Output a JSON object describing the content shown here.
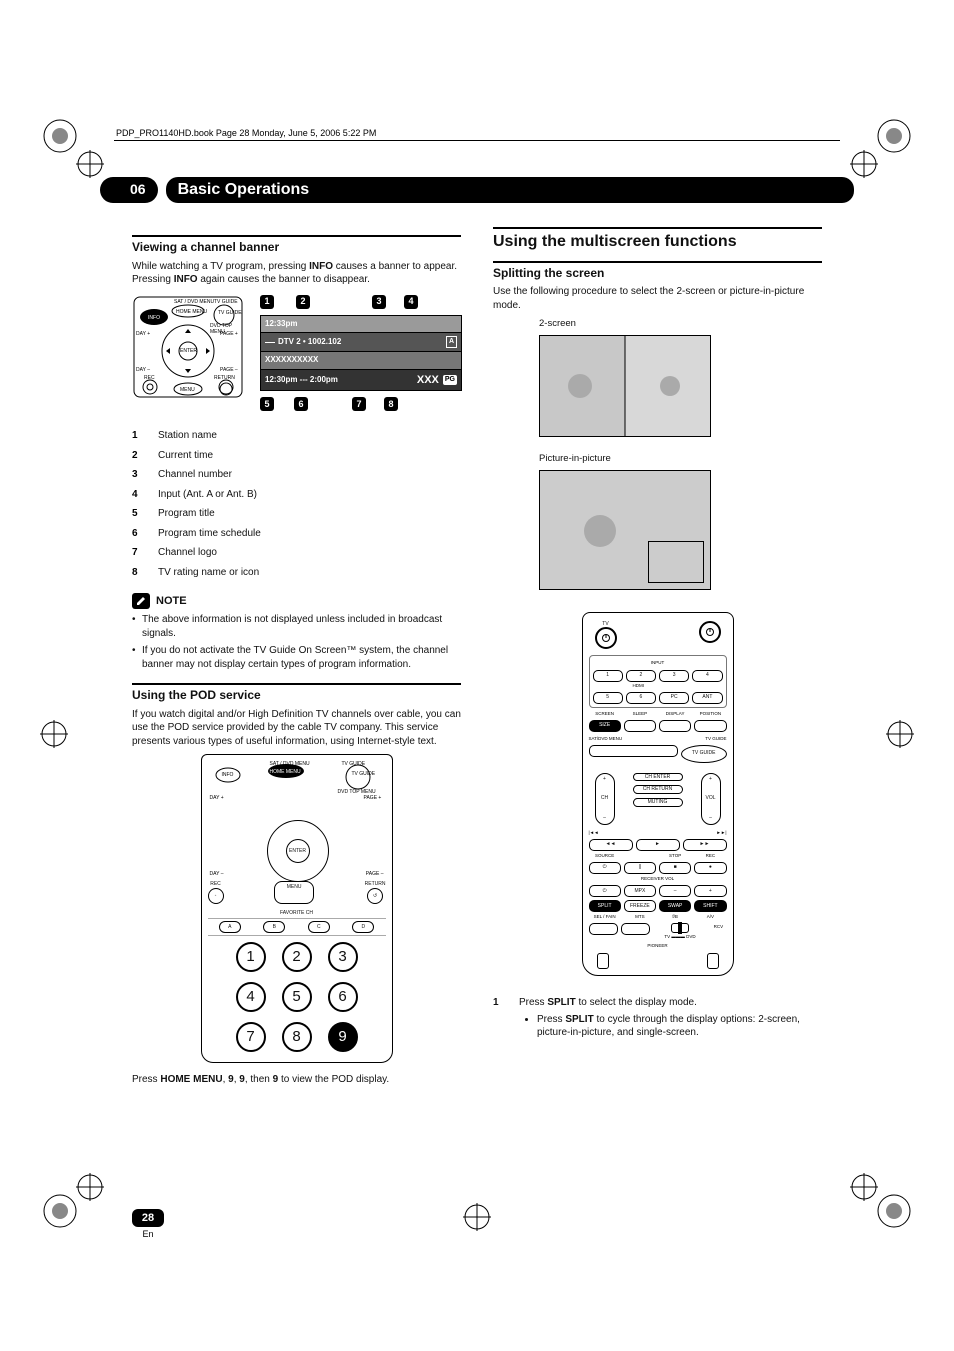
{
  "header_line": "PDP_PRO1140HD.book  Page 28  Monday, June 5, 2006  5:22 PM",
  "chapter_number": "06",
  "chapter_title": "Basic Operations",
  "page_number": "28",
  "page_lang": "En",
  "left": {
    "viewing": {
      "heading": "Viewing a channel banner",
      "p1_pre": "While watching a TV program, pressing ",
      "p1_b1": "INFO",
      "p1_mid": " causes a banner to appear. Pressing ",
      "p1_b2": "INFO",
      "p1_post": " again causes the banner to disappear.",
      "callouts": {
        "c1": "1",
        "c2": "2",
        "c3": "3",
        "c4": "4",
        "c5": "5",
        "c6": "6",
        "c7": "7",
        "c8": "8"
      },
      "osd": {
        "time": "12:33pm",
        "channel_line_pre": "DTV 2 • 1002.102",
        "ant": "A",
        "title_line": "XXXXXXXXXX",
        "sched": "12:30pm --- 2:00pm",
        "logo": "XXX",
        "rating_tag": "PG"
      },
      "legend": [
        {
          "n": "1",
          "t": "Station name"
        },
        {
          "n": "2",
          "t": "Current time"
        },
        {
          "n": "3",
          "t": "Channel number"
        },
        {
          "n": "4",
          "t": "Input (Ant. A or Ant. B)"
        },
        {
          "n": "5",
          "t": "Program title"
        },
        {
          "n": "6",
          "t": "Program time schedule"
        },
        {
          "n": "7",
          "t": "Channel logo"
        },
        {
          "n": "8",
          "t": "TV rating name or icon"
        }
      ],
      "note_label": "NOTE",
      "notes": [
        "The above information is not displayed unless included in broadcast signals.",
        "If you do not activate the TV Guide On Screen™ system, the channel banner may not display certain types of program information."
      ]
    },
    "pod": {
      "heading": "Using the POD service",
      "para": "If you watch digital and/or High Definition TV channels over cable, you can use the POD service provided by the cable TV company. This service presents various types of useful information, using Internet-style text.",
      "nums": [
        "1",
        "2",
        "3",
        "4",
        "5",
        "6",
        "7",
        "8",
        "9"
      ],
      "fav_label": "FAVORITE CH",
      "bottom_pre": "Press ",
      "bottom_b1": "HOME MENU",
      "bottom_mid1": ", ",
      "bottom_b2": "9",
      "bottom_mid2": ", ",
      "bottom_b3": "9",
      "bottom_mid3": ", then ",
      "bottom_b4": "9",
      "bottom_post": " to view the POD display."
    },
    "remote_mini_labels": {
      "info": "INFO",
      "sat": "SAT / DVD MENU",
      "home_menu": "HOME MENU",
      "tvguide_top": "TV GUIDE",
      "tvguide": "TV GUIDE",
      "day_plus": "DAY +",
      "day_minus": "DAY –",
      "page_plus": "PAGE +",
      "page_minus": "PAGE –",
      "enter": "ENTER",
      "rec": "REC",
      "return": "RETURN",
      "menu": "MENU",
      "dvd_top": "DVD TOP MENU"
    }
  },
  "right": {
    "heading": "Using the multiscreen functions",
    "split": {
      "heading": "Splitting the screen",
      "para": "Use the following procedure to select the 2-screen or picture-in-picture mode.",
      "fig1_label": "2-screen",
      "fig2_label": "Picture-in-picture"
    },
    "remote_full": {
      "tv": "TV",
      "input": "INPUT",
      "hdmi": "HDMI",
      "nums": [
        "1",
        "2",
        "3",
        "4",
        "5",
        "6"
      ],
      "pc": "PC",
      "ant": "ANT",
      "row3": [
        "SCREEN",
        "SLEEP",
        "DISPLAY",
        "POSITION"
      ],
      "size": "SIZE",
      "sat_menu": "SAT/DVD MENU",
      "tvguide_lbl": "TV GUIDE",
      "tvguide_btn": "TV GUIDE",
      "ch": "CH",
      "vol": "VOL",
      "plus": "+",
      "minus": "–",
      "ch_enter": "CH ENTER",
      "ch_return": "CH RETURN",
      "muting": "MUTING",
      "transport": [
        "◄◄",
        "►",
        "►►"
      ],
      "transport_lbl_l": "|◄◄",
      "transport_lbl_r": "►►|",
      "row_src": [
        "SOURCE",
        "",
        "STOP",
        "REC"
      ],
      "src_icons": [
        "⏻",
        "||",
        "■",
        "●"
      ],
      "rv_row_lbl": "RECEIVER  VOL",
      "rv_row": [
        "⏻",
        "MPX",
        "–",
        "+"
      ],
      "split_row": [
        "SPLIT",
        "FREEZE",
        "SWAP",
        "SHIFT"
      ],
      "bottom_lbls": [
        "SEL / FAIN",
        "MTS",
        "f/B",
        "A/V"
      ],
      "tv_dvd": "TV ▬▬▬ DVD",
      "rcv": "RCV",
      "pioneer": "PIONEER"
    },
    "step": {
      "n": "1",
      "text_pre": "Press ",
      "text_b": "SPLIT",
      "text_post": " to select the display mode.",
      "sub_pre": "Press ",
      "sub_b": "SPLIT",
      "sub_post": " to cycle through the display options: 2-screen, picture-in-picture, and single-screen."
    }
  }
}
